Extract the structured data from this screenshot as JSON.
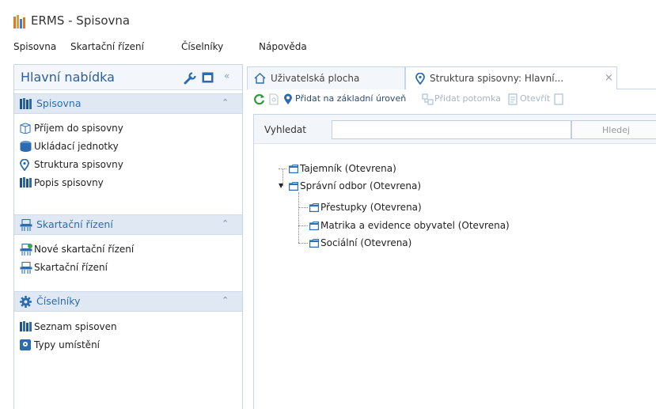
{
  "app": {
    "title": "ERMS - Spisovna"
  },
  "menubar": {
    "items": [
      {
        "label": "Spisovna"
      },
      {
        "label": "Skartační řízení"
      },
      {
        "label": "Číselníky"
      },
      {
        "label": "Nápověda"
      }
    ]
  },
  "sidebar": {
    "title": "Hlavní nabídka",
    "sections": [
      {
        "title": "Spisovna",
        "icon": "books-icon",
        "items": [
          {
            "label": "Příjem do spisovny",
            "icon": "box-icon"
          },
          {
            "label": "Ukládací jednotky",
            "icon": "cylinder-icon"
          },
          {
            "label": "Struktura spisovny",
            "icon": "location-pin-icon"
          },
          {
            "label": "Popis spisovny",
            "icon": "books-icon"
          }
        ]
      },
      {
        "title": "Skartační řízení",
        "icon": "shredder-icon",
        "items": [
          {
            "label": "Nové skartační řízení",
            "icon": "shredder-new-icon"
          },
          {
            "label": "Skartační řízení",
            "icon": "shredder-icon"
          }
        ]
      },
      {
        "title": "Číselníky",
        "icon": "gear-icon",
        "items": [
          {
            "label": "Seznam spisoven",
            "icon": "books-icon"
          },
          {
            "label": "Typy umístění",
            "icon": "place-type-icon"
          }
        ]
      }
    ]
  },
  "tabs": [
    {
      "label": "Uživatelská plocha",
      "icon": "home-icon",
      "active": false
    },
    {
      "label": "Struktura spisovny: Hlavní...",
      "icon": "location-pin-icon",
      "active": true
    }
  ],
  "toolbar": {
    "add_root": "Přidat na základní úroveň",
    "add_child": "Přidat potomka",
    "open": "Otevřít"
  },
  "search": {
    "label": "Vyhledat",
    "value": "",
    "button": "Hledej"
  },
  "tree": [
    {
      "label": "Tajemník (Otevrena)",
      "level": 0
    },
    {
      "label": "Správní odbor (Otevrena)",
      "level": 0,
      "expanded": true
    },
    {
      "label": "Přestupky (Otevrena)",
      "level": 1
    },
    {
      "label": "Matrika a evidence obyvatel (Otevrena)",
      "level": 1
    },
    {
      "label": "Sociální (Otevrena)",
      "level": 1
    }
  ],
  "colors": {
    "accent": "#2c6bb0",
    "section_bg": "#e0e9f3",
    "folder": "#2f6fb5",
    "refresh": "#2e9a3c",
    "logo": "#e0781e"
  }
}
